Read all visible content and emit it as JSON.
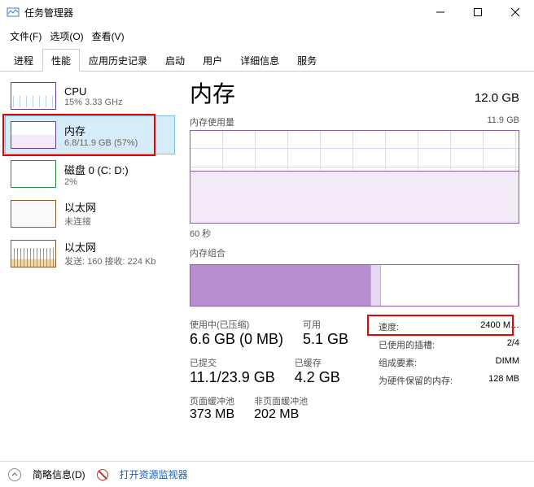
{
  "window": {
    "title": "任务管理器"
  },
  "menu": {
    "file": "文件(F)",
    "options": "选项(O)",
    "view": "查看(V)"
  },
  "tabs": {
    "processes": "进程",
    "performance": "性能",
    "apphistory": "应用历史记录",
    "startup": "启动",
    "users": "用户",
    "details": "详细信息",
    "services": "服务"
  },
  "sidebar": [
    {
      "title": "CPU",
      "sub": "15% 3.33 GHz"
    },
    {
      "title": "内存",
      "sub": "6.8/11.9 GB (57%)"
    },
    {
      "title": "磁盘 0 (C: D:)",
      "sub": "2%"
    },
    {
      "title": "以太网",
      "sub": "未连接"
    },
    {
      "title": "以太网",
      "sub": "发送: 160 接收: 224 Kb"
    }
  ],
  "main": {
    "title": "内存",
    "total": "12.0 GB",
    "usage_label": "内存使用量",
    "usage_max": "11.9 GB",
    "time_label": "60 秒",
    "compo_label": "内存组合",
    "stats": {
      "in_use_label": "使用中(已压缩)",
      "in_use": "6.6 GB (0 MB)",
      "avail_label": "可用",
      "avail": "5.1 GB",
      "commit_label": "已提交",
      "commit": "11.1/23.9 GB",
      "cached_label": "已缓存",
      "cached": "4.2 GB",
      "paged_label": "页面缓冲池",
      "paged": "373 MB",
      "nonpaged_label": "非页面缓冲池",
      "nonpaged": "202 MB"
    },
    "info": {
      "speed_label": "速度:",
      "speed": "2400 M…",
      "slots_label": "已使用的插槽:",
      "slots": "2/4",
      "form_label": "组成要素:",
      "form": "DIMM",
      "reserved_label": "为硬件保留的内存:",
      "reserved": "128 MB"
    }
  },
  "footer": {
    "brief": "简略信息(D)",
    "resmon": "打开资源监视器"
  },
  "chart_data": {
    "type": "area",
    "title": "内存使用量",
    "ylim": [
      0,
      11.9
    ],
    "ylabel": "GB",
    "x_seconds": 60,
    "current_used_gb": 6.8,
    "percent": 57
  }
}
